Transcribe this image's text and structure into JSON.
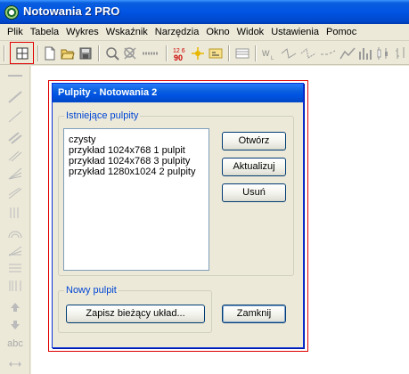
{
  "app": {
    "title": "Notowania 2 PRO"
  },
  "menu": [
    "Plik",
    "Tabela",
    "Wykres",
    "Wskaźnik",
    "Narzędzia",
    "Okno",
    "Widok",
    "Ustawienia",
    "Pomoc"
  ],
  "toolbar": {
    "icons": [
      "desktops-icon",
      "new-file-icon",
      "open-folder-icon",
      "save-icon",
      "zoom-icon",
      "filter-icon",
      "dash-icon",
      "numbers-icon",
      "arrows-icon",
      "notes-icon",
      "table-icon",
      "volume-icon",
      "line-arrow-icon",
      "line-arrow-2-icon",
      "line-arrow-3-icon",
      "trend-icon",
      "bars-icon",
      "candles-icon"
    ],
    "numbers_icon_text": "12 6\n90"
  },
  "dialog": {
    "title": "Pulpity - Notowania 2",
    "existing_group_label": "Istniejące pulpity",
    "items": [
      "czysty",
      "przykład 1024x768 1 pulpit",
      "przykład 1024x768 3 pulpity",
      "przykład 1280x1024 2 pulpity"
    ],
    "buttons": {
      "open": "Otwórz",
      "update": "Aktualizuj",
      "delete": "Usuń",
      "close": "Zamknij"
    },
    "new_group_label": "Nowy pulpit",
    "save_button": "Zapisz bieżący układ..."
  },
  "left_toolbar": {
    "text_tool": "abc"
  },
  "colors": {
    "titlebar": "#0054e3",
    "highlight": "#e00000",
    "group_label": "#0046d5"
  }
}
